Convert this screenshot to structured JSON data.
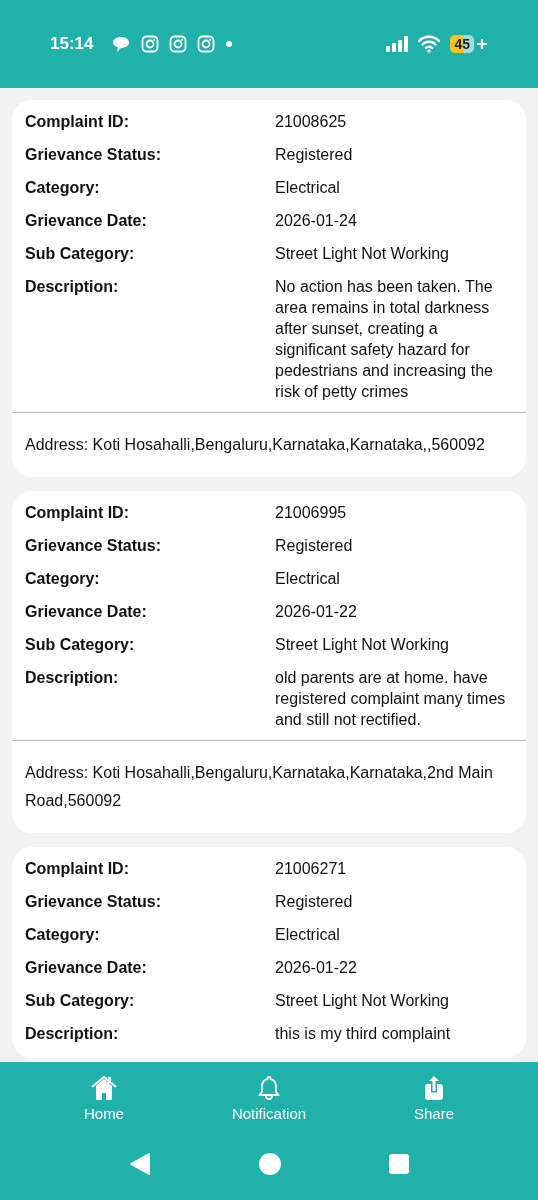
{
  "status_bar": {
    "time": "15:14",
    "battery": "45"
  },
  "complaints": [
    {
      "fields": [
        {
          "label": "Complaint ID:",
          "value": "21008625"
        },
        {
          "label": "Grievance Status:",
          "value": "Registered"
        },
        {
          "label": "Category:",
          "value": "Electrical"
        },
        {
          "label": "Grievance Date:",
          "value": "2026-01-24"
        },
        {
          "label": "Sub Category:",
          "value": "Street Light Not Working"
        },
        {
          "label": "Description:",
          "value": "No action has been taken. The area remains in total darkness after sunset, creating a significant safety hazard for pedestrians and increasing the risk of petty crimes"
        }
      ],
      "address": "Address: Koti Hosahalli,Bengaluru,Karnataka,Karnataka,,560092"
    },
    {
      "fields": [
        {
          "label": "Complaint ID:",
          "value": "21006995"
        },
        {
          "label": "Grievance Status:",
          "value": "Registered"
        },
        {
          "label": "Category:",
          "value": "Electrical"
        },
        {
          "label": "Grievance Date:",
          "value": "2026-01-22"
        },
        {
          "label": "Sub Category:",
          "value": "Street Light Not Working"
        },
        {
          "label": "Description:",
          "value": "old parents are at home. have registered complaint many times and still not rectified."
        }
      ],
      "address": "Address: Koti Hosahalli,Bengaluru,Karnataka,Karnataka,2nd Main Road,560092"
    },
    {
      "fields": [
        {
          "label": "Complaint ID:",
          "value": "21006271"
        },
        {
          "label": "Grievance Status:",
          "value": "Registered"
        },
        {
          "label": "Category:",
          "value": "Electrical"
        },
        {
          "label": "Grievance Date:",
          "value": "2026-01-22"
        },
        {
          "label": "Sub Category:",
          "value": "Street Light Not Working"
        },
        {
          "label": "Description:",
          "value": "this is my third complaint"
        }
      ]
    }
  ],
  "bottom_nav": [
    {
      "kind": "home",
      "label": "Home"
    },
    {
      "kind": "bell",
      "label": "Notification"
    },
    {
      "kind": "share",
      "label": "Share"
    }
  ]
}
